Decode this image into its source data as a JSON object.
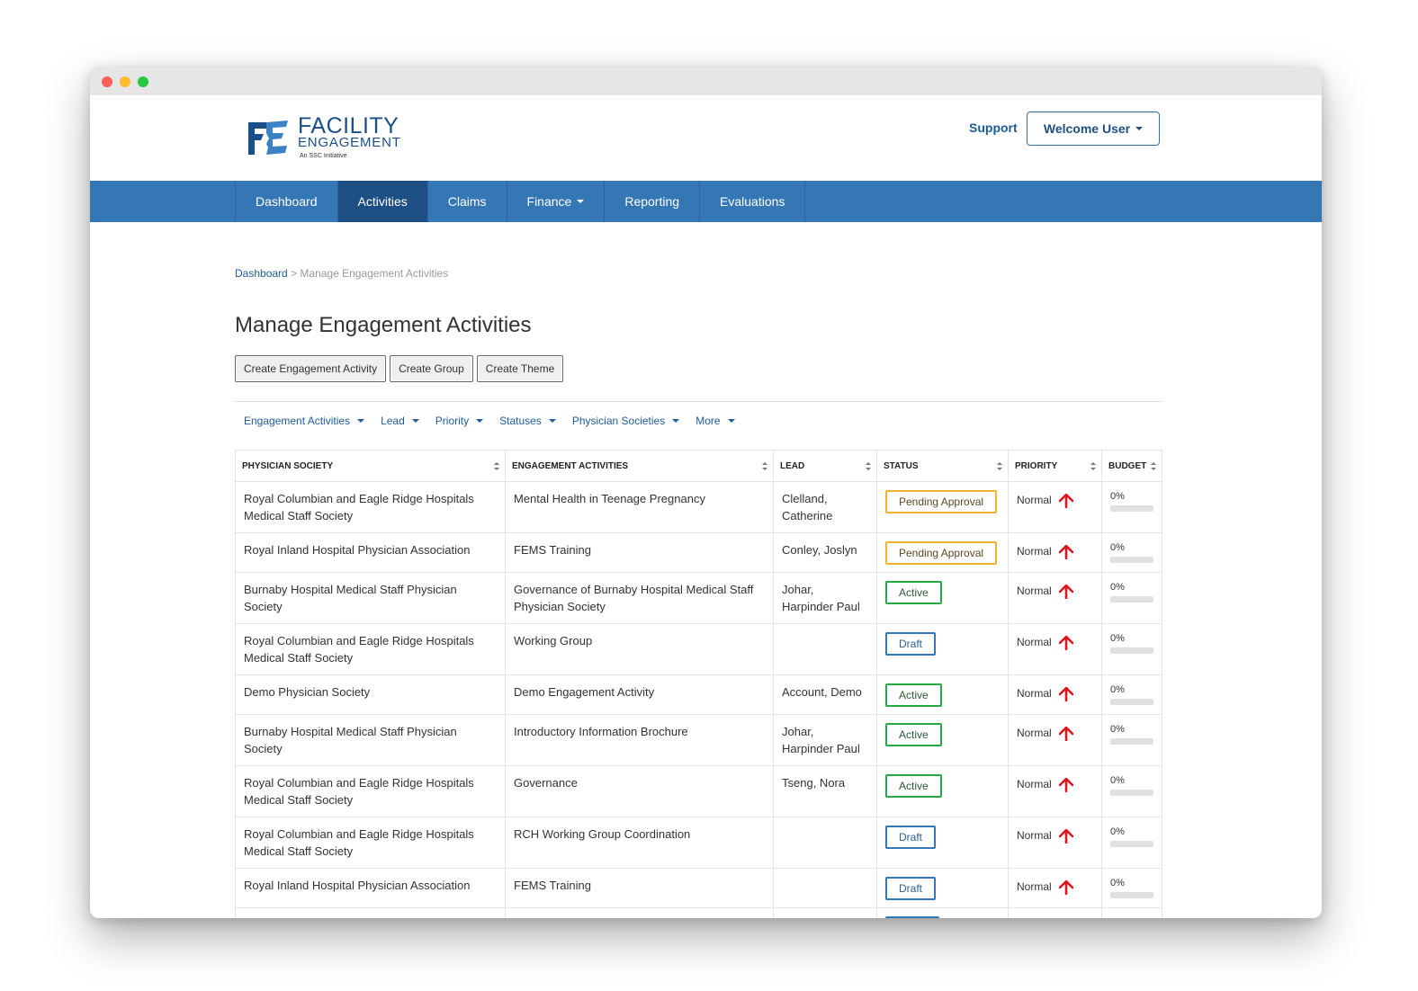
{
  "brand": {
    "line1": "FACILITY",
    "line2": "ENGAGEMENT",
    "line3": "An SSC Initiative"
  },
  "header": {
    "support": "Support",
    "welcome": "Welcome User"
  },
  "nav": {
    "dashboard": "Dashboard",
    "activities": "Activities",
    "claims": "Claims",
    "finance": "Finance",
    "reporting": "Reporting",
    "evaluations": "Evaluations"
  },
  "breadcrumb": {
    "home": "Dashboard",
    "separator": " > ",
    "current": "Manage Engagement Activities"
  },
  "page": {
    "title": "Manage Engagement Activities",
    "btn_create_activity": "Create Engagement Activity",
    "btn_create_group": "Create Group",
    "btn_create_theme": "Create Theme"
  },
  "filters": {
    "engagement_activities": "Engagement Activities",
    "lead": "Lead",
    "priority": "Priority",
    "statuses": "Statuses",
    "physician_societies": "Physician Societies",
    "more": "More"
  },
  "table": {
    "headers": {
      "society": "PHYSICIAN SOCIETY",
      "activity": "ENGAGEMENT ACTIVITIES",
      "lead": "LEAD",
      "status": "STATUS",
      "priority": "PRIORITY",
      "budget": "BUDGET"
    },
    "rows": [
      {
        "society": "Royal Columbian and Eagle Ridge Hospitals Medical Staff Society",
        "activity": "Mental Health in Teenage Pregnancy",
        "lead": "Clelland, Catherine",
        "status": "Pending Approval",
        "priority": "Normal",
        "budget": "0%",
        "budget_fraction": 0
      },
      {
        "society": "Royal Inland Hospital Physician Association",
        "activity": "FEMS Training",
        "lead": "Conley, Joslyn",
        "status": "Pending Approval",
        "priority": "Normal",
        "budget": "0%",
        "budget_fraction": 0
      },
      {
        "society": "Burnaby Hospital Medical Staff Physician Society",
        "activity": "Governance of Burnaby Hospital Medical Staff Physician Society",
        "lead": "Johar, Harpinder Paul",
        "status": "Active",
        "priority": "Normal",
        "budget": "0%",
        "budget_fraction": 0
      },
      {
        "society": "Royal Columbian and Eagle Ridge Hospitals Medical Staff Society",
        "activity": "Working Group",
        "lead": "",
        "status": "Draft",
        "priority": "Normal",
        "budget": "0%",
        "budget_fraction": 0
      },
      {
        "society": "Demo Physician Society",
        "activity": "Demo Engagement Activity",
        "lead": "Account, Demo",
        "status": "Active",
        "priority": "Normal",
        "budget": "0%",
        "budget_fraction": 0
      },
      {
        "society": "Burnaby Hospital Medical Staff Physician Society",
        "activity": "Introductory Information Brochure",
        "lead": "Johar, Harpinder Paul",
        "status": "Active",
        "priority": "Normal",
        "budget": "0%",
        "budget_fraction": 0
      },
      {
        "society": "Royal Columbian and Eagle Ridge Hospitals Medical Staff Society",
        "activity": "Governance",
        "lead": "Tseng, Nora",
        "status": "Active",
        "priority": "Normal",
        "budget": "0%",
        "budget_fraction": 0
      },
      {
        "society": "Royal Columbian and Eagle Ridge Hospitals Medical Staff Society",
        "activity": "RCH Working Group Coordination",
        "lead": "",
        "status": "Draft",
        "priority": "Normal",
        "budget": "0%",
        "budget_fraction": 0
      },
      {
        "society": "Royal Inland Hospital Physician Association",
        "activity": "FEMS Training",
        "lead": "",
        "status": "Draft",
        "priority": "Normal",
        "budget": "0%",
        "budget_fraction": 0
      }
    ]
  },
  "colors": {
    "nav": "#3577b5",
    "nav_active": "#1d4e84",
    "pending": "#f4b22f",
    "active": "#28a745",
    "draft": "#3577b5",
    "priority_arrow": "#e0141e"
  },
  "icons": {
    "priority": "arrow-up-icon",
    "dropdown": "caret-down-icon",
    "sort": "sort-icon"
  }
}
